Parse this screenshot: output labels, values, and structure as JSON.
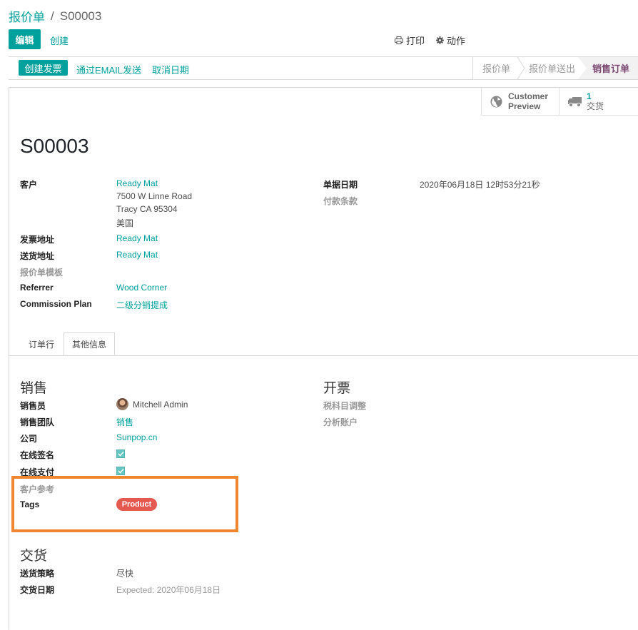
{
  "breadcrumb": {
    "parent": "报价单",
    "separator": "/",
    "current": "S00003"
  },
  "control": {
    "edit": "编辑",
    "create": "创建",
    "print": "打印",
    "action": "动作"
  },
  "statusbar": {
    "buttons": [
      "创建发票",
      "通过EMAIL发送",
      "取消日期"
    ],
    "stages": [
      "报价单",
      "报价单送出",
      "销售订单"
    ],
    "active_stage": "销售订单"
  },
  "smart_buttons": {
    "preview_line1": "Customer",
    "preview_line2": "Preview",
    "delivery_count": "1",
    "delivery_label": "交货"
  },
  "record": {
    "name": "S00003"
  },
  "left_fields": {
    "customer_label": "客户",
    "customer_name": "Ready Mat",
    "customer_addr1": "7500 W Linne Road",
    "customer_addr2": "Tracy CA 95304",
    "customer_addr3": "美国",
    "invoice_addr_label": "发票地址",
    "invoice_addr": "Ready Mat",
    "shipping_addr_label": "送货地址",
    "shipping_addr": "Ready Mat",
    "template_label": "报价单模板",
    "referrer_label": "Referrer",
    "referrer": "Wood Corner",
    "commission_label": "Commission Plan",
    "commission": "二级分销提成"
  },
  "right_fields": {
    "date_label": "单据日期",
    "date": "2020年06月18日 12时53分21秒",
    "payment_terms_label": "付款条款"
  },
  "tabs": [
    "订单行",
    "其他信息"
  ],
  "active_tab": "其他信息",
  "sales_section": {
    "title": "销售",
    "salesperson_label": "销售员",
    "salesperson": "Mitchell Admin",
    "team_label": "销售团队",
    "team": "销售",
    "company_label": "公司",
    "company": "Sunpop.cn",
    "online_sign_label": "在线签名",
    "online_sign": true,
    "online_pay_label": "在线支付",
    "online_pay": true,
    "customer_ref_label": "客户参考",
    "tags_label": "Tags",
    "tag": "Product"
  },
  "invoicing_section": {
    "title": "开票",
    "fiscal_label": "税科目调整",
    "analytic_label": "分析账户"
  },
  "delivery_section": {
    "title": "交货",
    "policy_label": "送货策略",
    "policy": "尽快",
    "date_label": "交货日期",
    "date": "Expected: 2020年06月18日"
  },
  "colors": {
    "primary": "#00a09d",
    "active_stage": "#7c4a73",
    "tag": "#e55a50",
    "highlight": "#f0862f"
  }
}
